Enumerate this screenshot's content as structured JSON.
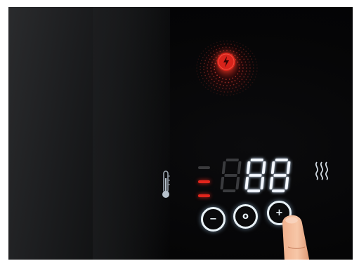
{
  "device": "electric-heater-control-panel",
  "power_button": {
    "icon": "power-icon",
    "state": "on",
    "color": "#d8231b"
  },
  "temperature": {
    "icon": "thermometer-icon",
    "level_bars": 3,
    "lit_bars": 2,
    "lit_color": "#e2251c",
    "unlit_color": "#3a3a3c"
  },
  "display": {
    "digits": "888",
    "lit_digits": [
      1,
      2
    ],
    "lit_color": "#f4f8ff",
    "unlit_color": "#3a3b3e"
  },
  "heat_indicator": {
    "icon": "heat-waves-icon"
  },
  "controls": [
    {
      "name": "minus-button",
      "symbol": "−"
    },
    {
      "name": "mode-button",
      "symbol": "o"
    },
    {
      "name": "plus-button",
      "symbol": "+"
    }
  ]
}
